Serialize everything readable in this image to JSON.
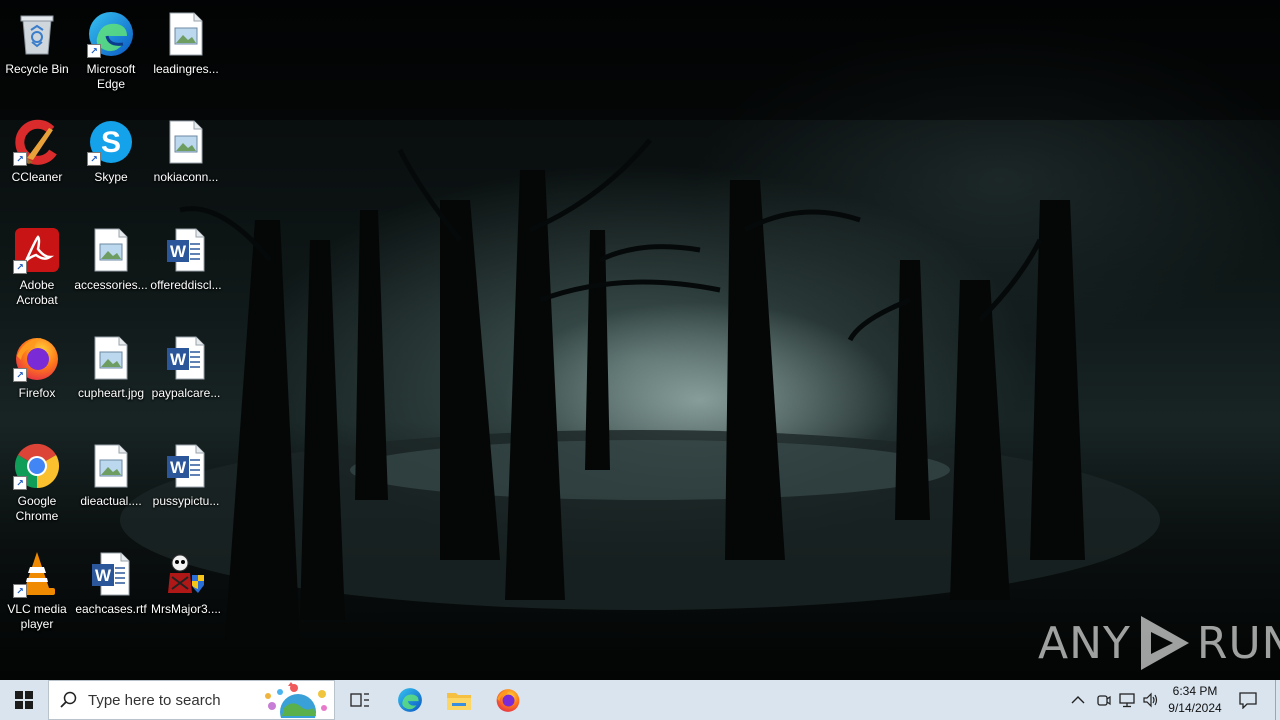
{
  "desktop": {
    "icons": [
      {
        "label": "Recycle Bin",
        "icon": "recycle-bin-icon"
      },
      {
        "label": "Microsoft Edge",
        "icon": "edge-icon",
        "shortcut": true
      },
      {
        "label": "leadingres...",
        "icon": "image-file-icon"
      },
      {
        "label": "CCleaner",
        "icon": "ccleaner-icon",
        "shortcut": true
      },
      {
        "label": "Skype",
        "icon": "skype-icon",
        "shortcut": true
      },
      {
        "label": "nokiaconn...",
        "icon": "image-file-icon"
      },
      {
        "label": "Adobe Acrobat",
        "icon": "acrobat-icon",
        "shortcut": true
      },
      {
        "label": "accessories...",
        "icon": "image-file-icon"
      },
      {
        "label": "offereddiscl...",
        "icon": "word-doc-icon"
      },
      {
        "label": "Firefox",
        "icon": "firefox-icon",
        "shortcut": true
      },
      {
        "label": "cupheart.jpg",
        "icon": "image-file-icon"
      },
      {
        "label": "paypalcare...",
        "icon": "word-doc-icon"
      },
      {
        "label": "Google Chrome",
        "icon": "chrome-icon",
        "shortcut": true
      },
      {
        "label": "dieactual....",
        "icon": "image-file-icon"
      },
      {
        "label": "pussypictu...",
        "icon": "word-doc-icon"
      },
      {
        "label": "VLC media player",
        "icon": "vlc-icon",
        "shortcut": true
      },
      {
        "label": "eachcases.rtf",
        "icon": "word-doc-icon"
      },
      {
        "label": "MrsMajor3....",
        "icon": "mrsmajor-icon"
      }
    ]
  },
  "watermark": {
    "text_left": "ANY",
    "text_right": "RUN"
  },
  "taskbar": {
    "search_placeholder": "Type here to search",
    "pinned": [
      "task-view-icon",
      "edge-icon",
      "file-explorer-icon",
      "firefox-icon"
    ],
    "tray": [
      "chevron-up-icon",
      "meet-now-icon",
      "network-icon",
      "volume-icon"
    ],
    "clock_time": "6:34 PM",
    "clock_date": "9/14/2024",
    "notification_icon": "notification-icon"
  },
  "colors": {
    "taskbar_bg": "#d9e4ef",
    "accent": "#0078d7"
  }
}
